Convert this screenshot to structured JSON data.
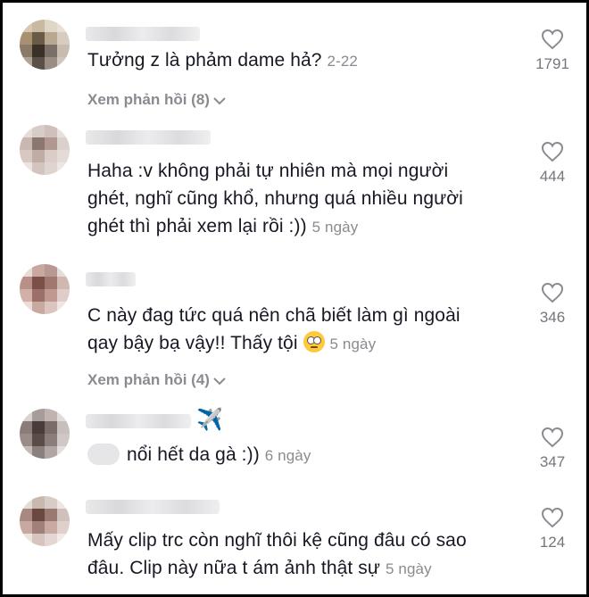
{
  "comments": [
    {
      "text": "Tưởng z là phảm dame hả?",
      "date": "2-22",
      "likes": "1791",
      "replies": "Xem phản hồi (8)"
    },
    {
      "text_lines": [
        "Haha :v không phải tự nhiên mà mọi người",
        "ghét, nghĩ cũng khổ, nhưng quá nhiều người",
        "ghét thì phải xem lại rồi :))"
      ],
      "date": "5 ngày",
      "likes": "444"
    },
    {
      "text_lines": [
        "C này đag tức quá nên chã biết làm gì ngoài",
        "qay bậy bạ vậy!! Thấy tội"
      ],
      "date": "5 ngày",
      "likes": "346",
      "replies": "Xem phản hồi (4)",
      "emoji": "face-with-rolling-eyes"
    },
    {
      "text": "nổi hết da gà :))",
      "date": "6 ngày",
      "likes": "347",
      "name_emoji": "✈️"
    },
    {
      "text_lines": [
        "Mấy clip trc còn nghĩ thôi kệ cũng đâu có sao",
        "đâu. Clip này nữa t ám ảnh thật sự"
      ],
      "date": "5 ngày",
      "likes": "124"
    }
  ],
  "colors": {
    "text": "#161823",
    "meta": "#8a8b91",
    "like_count": "#75767d",
    "frame": "#000000"
  },
  "icons": {
    "like": "heart-outline-icon",
    "expand": "chevron-down-icon"
  }
}
